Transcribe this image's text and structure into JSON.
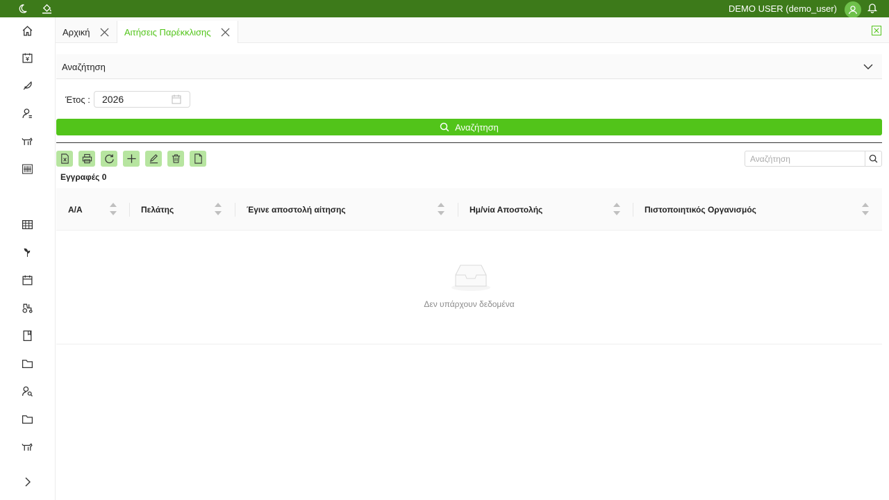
{
  "topbar": {
    "user_label": "DEMO USER (demo_user)",
    "icons": [
      "moon-icon",
      "paint-bucket-icon",
      "avatar-icon",
      "bell-icon"
    ],
    "background": "#3d7a1a"
  },
  "sidebar": {
    "items": [
      {
        "icon": "home-icon"
      },
      {
        "icon": "calendar-money-icon"
      },
      {
        "icon": "feather-icon"
      },
      {
        "icon": "user-list-icon"
      },
      {
        "icon": "livestock-icon"
      },
      {
        "icon": "barcode-icon"
      },
      {
        "icon": "table-icon"
      },
      {
        "icon": "plant-icon"
      },
      {
        "icon": "calendar-icon"
      },
      {
        "icon": "tractor-icon"
      },
      {
        "icon": "book-icon"
      },
      {
        "icon": "folder-icon"
      },
      {
        "icon": "user-search-icon"
      },
      {
        "icon": "folder-icon"
      },
      {
        "icon": "livestock-icon"
      }
    ],
    "expand_icon": "chevron-right-icon"
  },
  "tabs": [
    {
      "label": "Αρχική",
      "active": false
    },
    {
      "label": "Αιτήσεις Παρέκκλισης",
      "active": true
    }
  ],
  "search_panel": {
    "title": "Αναζήτηση",
    "year_label": "Έτος :",
    "year_value": "2026",
    "search_button": "Αναζήτηση"
  },
  "toolbar": {
    "buttons": [
      "excel-icon",
      "print-icon",
      "refresh-icon",
      "add-icon",
      "edit-icon",
      "delete-icon",
      "document-icon"
    ]
  },
  "table_search": {
    "placeholder": "Αναζήτηση"
  },
  "records_label": "Εγγραφές 0",
  "table": {
    "columns": [
      "Α/Α",
      "Πελάτης",
      "Έγινε αποστολή αίτησης",
      "Ημ/νία Αποστολής",
      "Πιστοποιητικός Οργανισμός"
    ],
    "rows": [],
    "empty_text": "Δεν υπάρχουν δεδομένα"
  },
  "colors": {
    "accent": "#52c41a",
    "header_green": "#3d7a1a",
    "tool_bg": "#b7e5a0"
  }
}
